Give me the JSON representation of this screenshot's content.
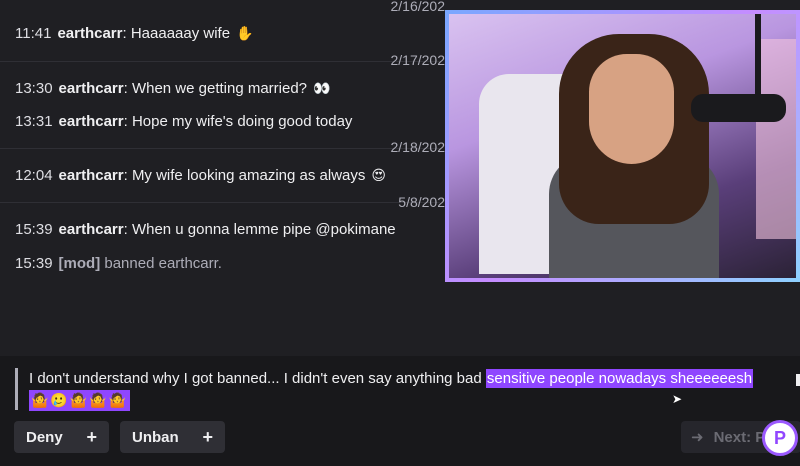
{
  "chat": {
    "dates": [
      "2/16/202",
      "2/17/202",
      "2/18/202",
      "5/8/202"
    ],
    "messages": [
      {
        "time": "11:41",
        "user": "earthcarr",
        "text": "Haaaaaay wife",
        "emoji": "✋"
      },
      {
        "time": "13:30",
        "user": "earthcarr",
        "text": "When we getting married?",
        "emoji": "👀"
      },
      {
        "time": "13:31",
        "user": "earthcarr",
        "text": "Hope my wife's doing good today",
        "emoji": ""
      },
      {
        "time": "12:04",
        "user": "earthcarr",
        "text": "My wife looking amazing as always",
        "emoji": "😍"
      },
      {
        "time": "15:39",
        "user": "earthcarr",
        "text": "When u gonna lemme pipe @pokimane",
        "emoji": ""
      }
    ],
    "mod_action": {
      "time": "15:39",
      "tag": "[mod]",
      "text": "banned earthcarr."
    }
  },
  "appeal": {
    "text_plain": "I don't understand why I got banned... I didn't even say anything bad ",
    "text_highlight": "sensitive people nowadays sheeeeeesh",
    "emojis": "🤷🥲🤷🤷🤷"
  },
  "actions": {
    "deny_label": "Deny",
    "unban_label": "Unban",
    "next_label": "Next: P"
  },
  "colors": {
    "background": "#18181b",
    "highlight": "#8f46ff",
    "button": "#2f2f35"
  }
}
